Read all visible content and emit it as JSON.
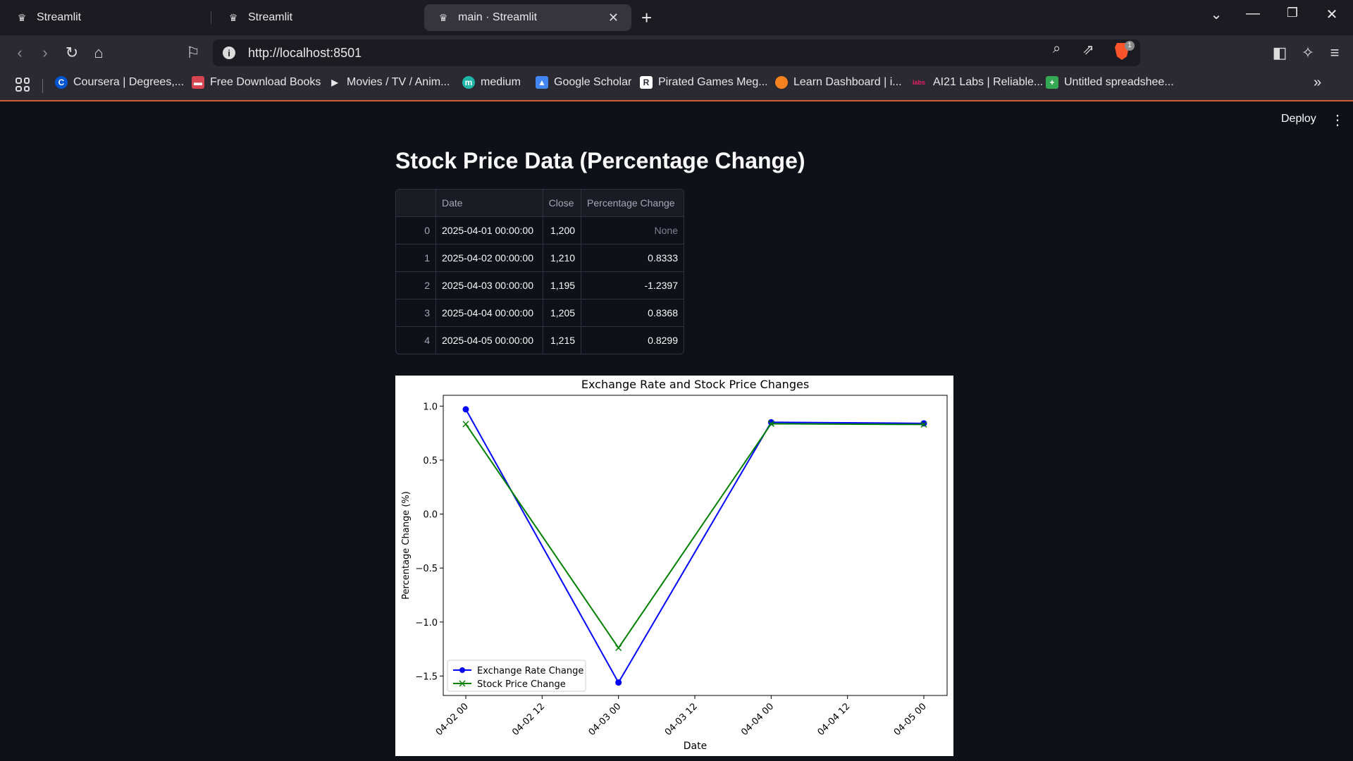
{
  "browser": {
    "tabs": [
      {
        "label": "Streamlit",
        "active": false
      },
      {
        "label": "Streamlit",
        "active": false
      },
      {
        "label": "main · Streamlit",
        "active": true
      }
    ],
    "url": "http://localhost:8501",
    "bookmarks": [
      {
        "label": "Coursera | Degrees,...",
        "icon": "coursera-icon",
        "color": "#0056d2"
      },
      {
        "label": "Free Download Books",
        "icon": "book-icon",
        "color": "#d64550"
      },
      {
        "label": "Movies / TV / Anim...",
        "icon": "play-icon",
        "color": "#e8e8e8"
      },
      {
        "label": "medium",
        "icon": "medium-icon",
        "color": "#1fb6a8"
      },
      {
        "label": "Google Scholar",
        "icon": "scholar-icon",
        "color": "#4285f4"
      },
      {
        "label": "Pirated Games Meg...",
        "icon": "r-icon",
        "color": "#ffffff"
      },
      {
        "label": "Learn Dashboard | i...",
        "icon": "learn-icon",
        "color": "#f5821f"
      },
      {
        "label": "AI21 Labs | Reliable...",
        "icon": "labs-icon",
        "color": "#e91e63"
      },
      {
        "label": "Untitled spreadshee...",
        "icon": "sheets-icon",
        "color": "#34a853"
      }
    ],
    "brave_badge": "1"
  },
  "app": {
    "deploy_label": "Deploy",
    "title": "Stock Price Data (Percentage Change)",
    "table": {
      "columns": [
        "",
        "Date",
        "Close",
        "Percentage Change"
      ],
      "rows": [
        {
          "index": "0",
          "date": "2025-04-01 00:00:00",
          "close": "1,200",
          "pct": "None"
        },
        {
          "index": "1",
          "date": "2025-04-02 00:00:00",
          "close": "1,210",
          "pct": "0.8333"
        },
        {
          "index": "2",
          "date": "2025-04-03 00:00:00",
          "close": "1,195",
          "pct": "-1.2397"
        },
        {
          "index": "3",
          "date": "2025-04-04 00:00:00",
          "close": "1,205",
          "pct": "0.8368"
        },
        {
          "index": "4",
          "date": "2025-04-05 00:00:00",
          "close": "1,215",
          "pct": "0.8299"
        }
      ]
    }
  },
  "chart_data": {
    "type": "line",
    "title": "Exchange Rate and Stock Price Changes",
    "xlabel": "Date",
    "ylabel": "Percentage Change (%)",
    "x": [
      "2025-04-02 00:00",
      "2025-04-03 00:00",
      "2025-04-04 00:00",
      "2025-04-05 00:00"
    ],
    "x_ticks": [
      "04-02 00",
      "04-02 12",
      "04-03 00",
      "04-03 12",
      "04-04 00",
      "04-04 12",
      "04-05 00"
    ],
    "y_ticks": [
      "1.0",
      "0.5",
      "0.0",
      "−0.5",
      "−1.0",
      "−1.5"
    ],
    "ylim": [
      -1.68,
      1.1
    ],
    "series": [
      {
        "name": "Exchange Rate Change",
        "color": "#0000ff",
        "marker": "o",
        "values": [
          0.97,
          -1.56,
          0.85,
          0.84
        ]
      },
      {
        "name": "Stock Price Change",
        "color": "#008000",
        "marker": "x",
        "values": [
          0.8333,
          -1.2397,
          0.8368,
          0.8299
        ]
      }
    ],
    "legend": "lower-left",
    "grid": false
  }
}
